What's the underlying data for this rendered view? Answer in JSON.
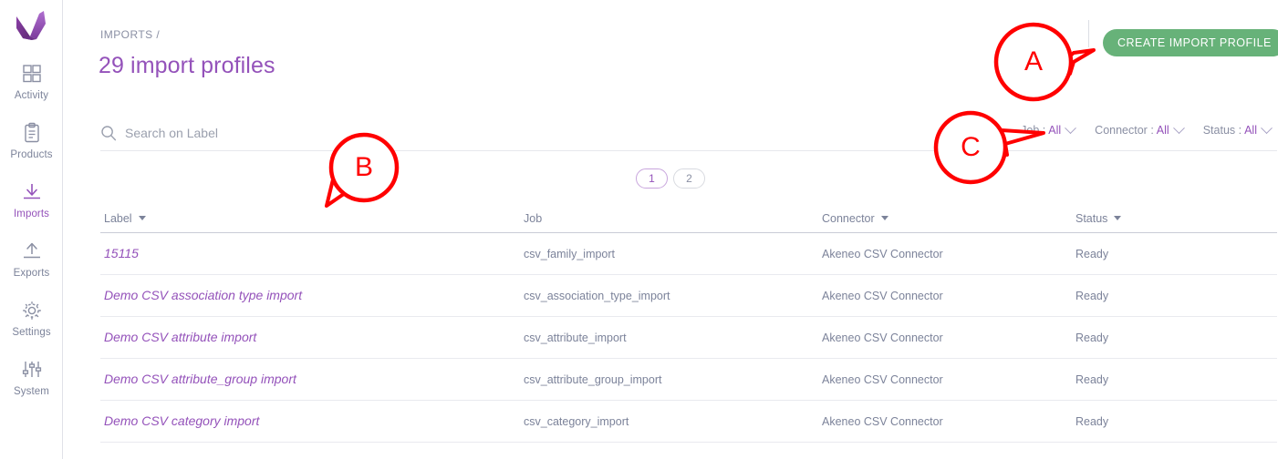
{
  "sidebar": {
    "logo_name": "akeneo-logo",
    "items": [
      {
        "label": "Activity",
        "icon": "grid-icon",
        "active": false
      },
      {
        "label": "Products",
        "icon": "clipboard-icon",
        "active": false
      },
      {
        "label": "Imports",
        "icon": "download-icon",
        "active": true
      },
      {
        "label": "Exports",
        "icon": "upload-icon",
        "active": false
      },
      {
        "label": "Settings",
        "icon": "gear-icon",
        "active": false
      },
      {
        "label": "System",
        "icon": "sliders-icon",
        "active": false
      }
    ]
  },
  "header": {
    "breadcrumb": "IMPORTS /",
    "title": "29 import profiles",
    "create_button": "CREATE IMPORT PROFILE",
    "create_button_color": "#67b279"
  },
  "search": {
    "placeholder": "Search on Label",
    "value": "",
    "icon": "search-icon"
  },
  "filters": [
    {
      "label": "Job :",
      "value": "All"
    },
    {
      "label": "Connector :",
      "value": "All"
    },
    {
      "label": "Status :",
      "value": "All"
    }
  ],
  "pagination": {
    "pages": [
      "1",
      "2"
    ],
    "current": "1"
  },
  "table": {
    "columns": [
      {
        "label": "Label",
        "sortable": true
      },
      {
        "label": "Job",
        "sortable": false
      },
      {
        "label": "Connector",
        "sortable": true
      },
      {
        "label": "Status",
        "sortable": true
      }
    ],
    "rows": [
      {
        "label": "15115",
        "job": "csv_family_import",
        "connector": "Akeneo CSV Connector",
        "status": "Ready"
      },
      {
        "label": "Demo CSV association type import",
        "job": "csv_association_type_import",
        "connector": "Akeneo CSV Connector",
        "status": "Ready"
      },
      {
        "label": "Demo CSV attribute import",
        "job": "csv_attribute_import",
        "connector": "Akeneo CSV Connector",
        "status": "Ready"
      },
      {
        "label": "Demo CSV attribute_group import",
        "job": "csv_attribute_group_import",
        "connector": "Akeneo CSV Connector",
        "status": "Ready"
      },
      {
        "label": "Demo CSV category import",
        "job": "csv_category_import",
        "connector": "Akeneo CSV Connector",
        "status": "Ready"
      }
    ]
  },
  "annotations": {
    "color": "#ff0000",
    "markers": [
      {
        "id": "A",
        "letter": "A",
        "target": "create-import-profile-button"
      },
      {
        "id": "B",
        "letter": "B",
        "target": "table-area"
      },
      {
        "id": "C",
        "letter": "C",
        "target": "filters"
      }
    ]
  },
  "theme": {
    "accent_purple": "#9452ba",
    "text_gray": "#7c839a",
    "border_gray": "#e9eaef"
  }
}
